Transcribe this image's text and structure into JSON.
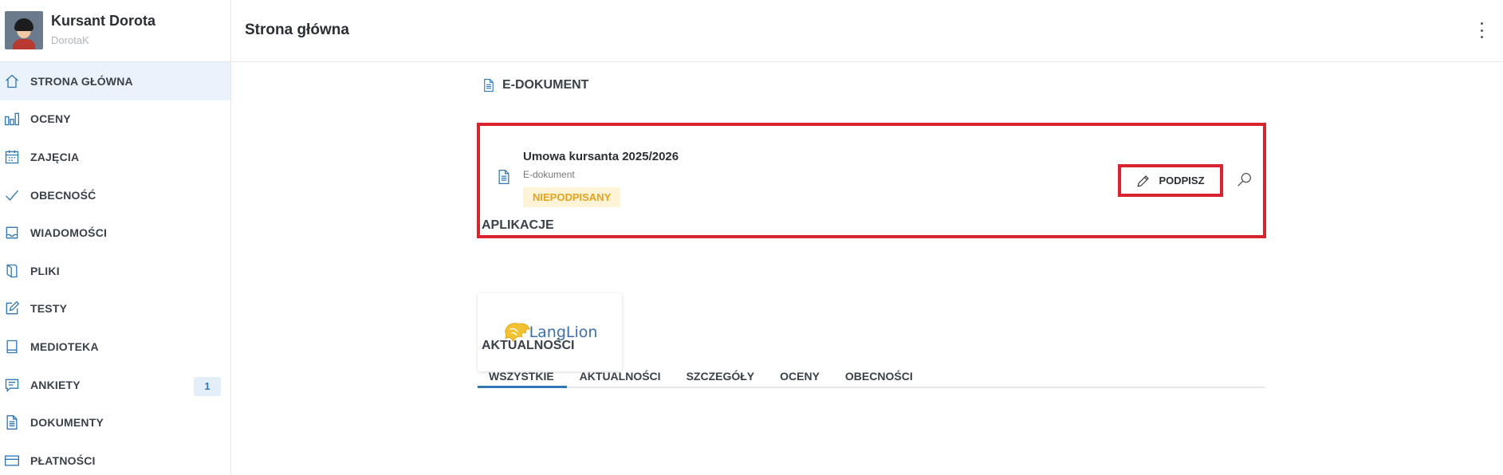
{
  "profile": {
    "name": "Kursant Dorota",
    "login": "DorotaK"
  },
  "header": {
    "title": "Strona główna"
  },
  "sidebar": {
    "items": [
      {
        "label": "STRONA GŁÓWNA",
        "icon": "home-icon",
        "active": true
      },
      {
        "label": "OCENY",
        "icon": "bar-chart-icon"
      },
      {
        "label": "ZAJĘCIA",
        "icon": "calendar-icon"
      },
      {
        "label": "OBECNOŚĆ",
        "icon": "check-icon"
      },
      {
        "label": "WIADOMOŚCI",
        "icon": "inbox-icon"
      },
      {
        "label": "PLIKI",
        "icon": "folder-icon"
      },
      {
        "label": "TESTY",
        "icon": "edit-icon"
      },
      {
        "label": "MEDIOTEKA",
        "icon": "book-icon"
      },
      {
        "label": "ANKIETY",
        "icon": "chat-icon",
        "badge": "1"
      },
      {
        "label": "DOKUMENTY",
        "icon": "document-icon"
      },
      {
        "label": "PŁATNOŚCI",
        "icon": "card-icon"
      }
    ]
  },
  "edoc": {
    "section_title": "E-DOKUMENT",
    "title": "Umowa kursanta 2025/2026",
    "subtitle": "E-dokument",
    "status": "NIEPODPISANY",
    "sign_label": "PODPISZ"
  },
  "apps": {
    "section_title": "APLIKACJE",
    "items": [
      {
        "name": "LangLion"
      }
    ]
  },
  "news": {
    "section_title": "AKTUALNOŚCI",
    "tabs": [
      "WSZYSTKIE",
      "AKTUALNOŚCI",
      "SZCZEGÓŁY",
      "OCENY",
      "OBECNOŚCI"
    ]
  },
  "colors": {
    "accent": "#2f77b5",
    "highlight": "#d9232e",
    "status_warn": "#e8a21c"
  }
}
